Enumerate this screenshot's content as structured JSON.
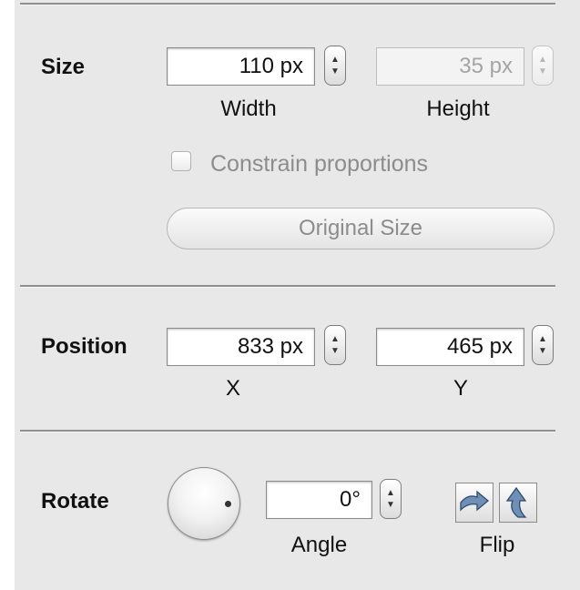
{
  "size": {
    "label": "Size",
    "width_value": "110 px",
    "width_caption": "Width",
    "height_value": "35 px",
    "height_caption": "Height",
    "constrain_label": "Constrain proportions",
    "constrain_checked": false,
    "original_size_label": "Original Size"
  },
  "position": {
    "label": "Position",
    "x_value": "833 px",
    "x_caption": "X",
    "y_value": "465 px",
    "y_caption": "Y"
  },
  "rotate": {
    "label": "Rotate",
    "angle_value": "0°",
    "angle_caption": "Angle",
    "flip_caption": "Flip"
  },
  "stepper_glyphs": {
    "up": "▲",
    "down": "▼"
  },
  "icons": {
    "knob": "rotation-knob-icon",
    "flip_horizontal": "flip-horizontal-icon",
    "flip_vertical": "flip-vertical-icon"
  },
  "colors": {
    "panel_bg": "#e8e8e8",
    "flip_arrow": "#6f8fb6"
  }
}
